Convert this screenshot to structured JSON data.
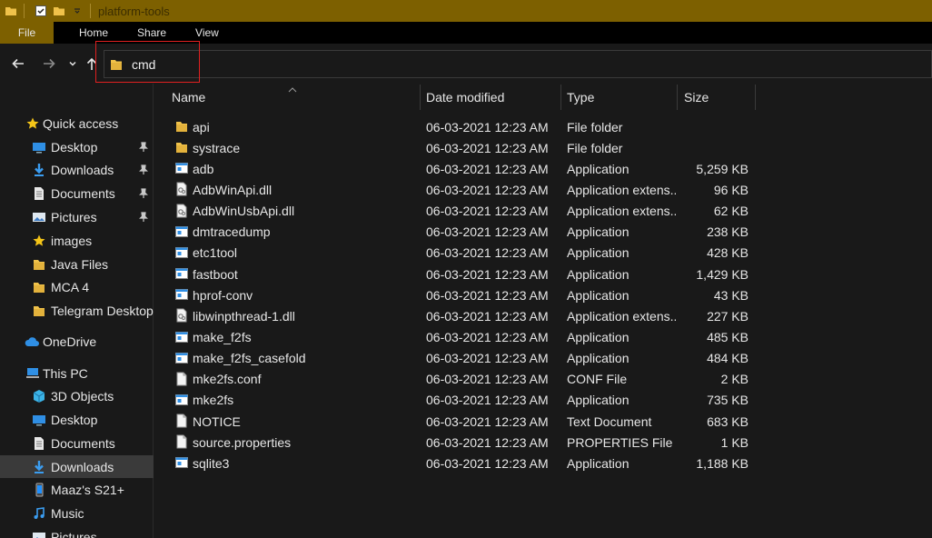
{
  "window": {
    "title": "platform-tools"
  },
  "ribbon": {
    "tabs": [
      "File",
      "Home",
      "Share",
      "View"
    ]
  },
  "address_bar": {
    "value": "cmd",
    "icon": "folder-icon"
  },
  "colors": {
    "accent": "#7d6000",
    "folder": "#f0c24a",
    "highlight": "#e02020"
  },
  "sidebar": {
    "items": [
      {
        "label": "Quick access",
        "icon": "star-icon",
        "pinned": false
      },
      {
        "label": "Desktop",
        "icon": "desktop-icon",
        "pinned": true
      },
      {
        "label": "Downloads",
        "icon": "download-icon",
        "pinned": true
      },
      {
        "label": "Documents",
        "icon": "documents-icon",
        "pinned": true
      },
      {
        "label": "Pictures",
        "icon": "pictures-icon",
        "pinned": true
      },
      {
        "label": "images",
        "icon": "star-icon",
        "pinned": false
      },
      {
        "label": "Java Files",
        "icon": "folder-icon",
        "pinned": false
      },
      {
        "label": "MCA 4",
        "icon": "folder-icon",
        "pinned": false
      },
      {
        "label": "Telegram Desktop",
        "icon": "folder-icon",
        "pinned": false
      },
      {
        "label": "OneDrive",
        "icon": "cloud-icon",
        "pinned": false
      },
      {
        "label": "This PC",
        "icon": "computer-icon",
        "pinned": false
      },
      {
        "label": "3D Objects",
        "icon": "cube-icon",
        "pinned": false
      },
      {
        "label": "Desktop",
        "icon": "desktop-icon",
        "pinned": false
      },
      {
        "label": "Documents",
        "icon": "documents-icon",
        "pinned": false
      },
      {
        "label": "Downloads",
        "icon": "download-icon",
        "pinned": false
      },
      {
        "label": "Maaz's S21+",
        "icon": "phone-icon",
        "pinned": false
      },
      {
        "label": "Music",
        "icon": "music-icon",
        "pinned": false
      },
      {
        "label": "Pictures",
        "icon": "pictures-icon",
        "pinned": false
      }
    ],
    "selected": "Downloads"
  },
  "file_list": {
    "columns": {
      "name": "Name",
      "date": "Date modified",
      "type": "Type",
      "size": "Size"
    },
    "rows": [
      {
        "name": "api",
        "date": "06-03-2021 12:23 AM",
        "type": "File folder",
        "size": "",
        "icon": "folder-icon"
      },
      {
        "name": "systrace",
        "date": "06-03-2021 12:23 AM",
        "type": "File folder",
        "size": "",
        "icon": "folder-icon"
      },
      {
        "name": "adb",
        "date": "06-03-2021 12:23 AM",
        "type": "Application",
        "size": "5,259 KB",
        "icon": "app-icon"
      },
      {
        "name": "AdbWinApi.dll",
        "date": "06-03-2021 12:23 AM",
        "type": "Application extens...",
        "size": "96 KB",
        "icon": "dll-icon"
      },
      {
        "name": "AdbWinUsbApi.dll",
        "date": "06-03-2021 12:23 AM",
        "type": "Application extens...",
        "size": "62 KB",
        "icon": "dll-icon"
      },
      {
        "name": "dmtracedump",
        "date": "06-03-2021 12:23 AM",
        "type": "Application",
        "size": "238 KB",
        "icon": "app-icon"
      },
      {
        "name": "etc1tool",
        "date": "06-03-2021 12:23 AM",
        "type": "Application",
        "size": "428 KB",
        "icon": "app-icon"
      },
      {
        "name": "fastboot",
        "date": "06-03-2021 12:23 AM",
        "type": "Application",
        "size": "1,429 KB",
        "icon": "app-icon"
      },
      {
        "name": "hprof-conv",
        "date": "06-03-2021 12:23 AM",
        "type": "Application",
        "size": "43 KB",
        "icon": "app-icon"
      },
      {
        "name": "libwinpthread-1.dll",
        "date": "06-03-2021 12:23 AM",
        "type": "Application extens...",
        "size": "227 KB",
        "icon": "dll-icon"
      },
      {
        "name": "make_f2fs",
        "date": "06-03-2021 12:23 AM",
        "type": "Application",
        "size": "485 KB",
        "icon": "app-icon"
      },
      {
        "name": "make_f2fs_casefold",
        "date": "06-03-2021 12:23 AM",
        "type": "Application",
        "size": "484 KB",
        "icon": "app-icon"
      },
      {
        "name": "mke2fs.conf",
        "date": "06-03-2021 12:23 AM",
        "type": "CONF File",
        "size": "2 KB",
        "icon": "file-icon"
      },
      {
        "name": "mke2fs",
        "date": "06-03-2021 12:23 AM",
        "type": "Application",
        "size": "735 KB",
        "icon": "app-icon"
      },
      {
        "name": "NOTICE",
        "date": "06-03-2021 12:23 AM",
        "type": "Text Document",
        "size": "683 KB",
        "icon": "file-icon"
      },
      {
        "name": "source.properties",
        "date": "06-03-2021 12:23 AM",
        "type": "PROPERTIES File",
        "size": "1 KB",
        "icon": "file-icon"
      },
      {
        "name": "sqlite3",
        "date": "06-03-2021 12:23 AM",
        "type": "Application",
        "size": "1,188 KB",
        "icon": "app-icon"
      }
    ]
  }
}
